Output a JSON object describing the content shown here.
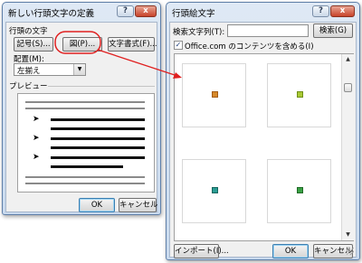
{
  "dialog1": {
    "title": "新しい行頭文字の定義",
    "help_glyph": "?",
    "close_glyph": "x",
    "section_label": "行頭の文字",
    "symbol_button": "記号(S)...",
    "picture_button": "図(P)...",
    "font_button": "文字書式(F)...",
    "alignment_label": "配置(M):",
    "alignment_value": "左揃え",
    "preview_label": "プレビュー",
    "bullet_glyph": "➤",
    "ok_button": "OK",
    "cancel_button": "キャンセル"
  },
  "dialog2": {
    "title": "行頭絵文字",
    "help_glyph": "?",
    "close_glyph": "x",
    "search_label": "検索文字列(T):",
    "search_value": "",
    "search_button": "検索(G)",
    "checkbox_checked": true,
    "checkbox_mark": "✓",
    "checkbox_label": "Office.com のコンテンツを含める(I)",
    "pictures": [
      {
        "name": "orange-bullet",
        "color": "#d7892a"
      },
      {
        "name": "green-bullet",
        "color": "#a9c934"
      },
      {
        "name": "teal-bullet",
        "color": "#2a9c93"
      },
      {
        "name": "dark-green-bullet",
        "color": "#3aa044"
      }
    ],
    "import_button": "インポート(I)...",
    "ok_button": "OK",
    "cancel_button": "キャンセル",
    "scroll_up_glyph": "▲",
    "scroll_down_glyph": "▼"
  },
  "colors": {
    "highlight": "#e02020",
    "title_bar": "#c9daee"
  },
  "icons": {
    "dropdown": "chevron-down-icon",
    "arrow": "red-arrow-icon"
  }
}
